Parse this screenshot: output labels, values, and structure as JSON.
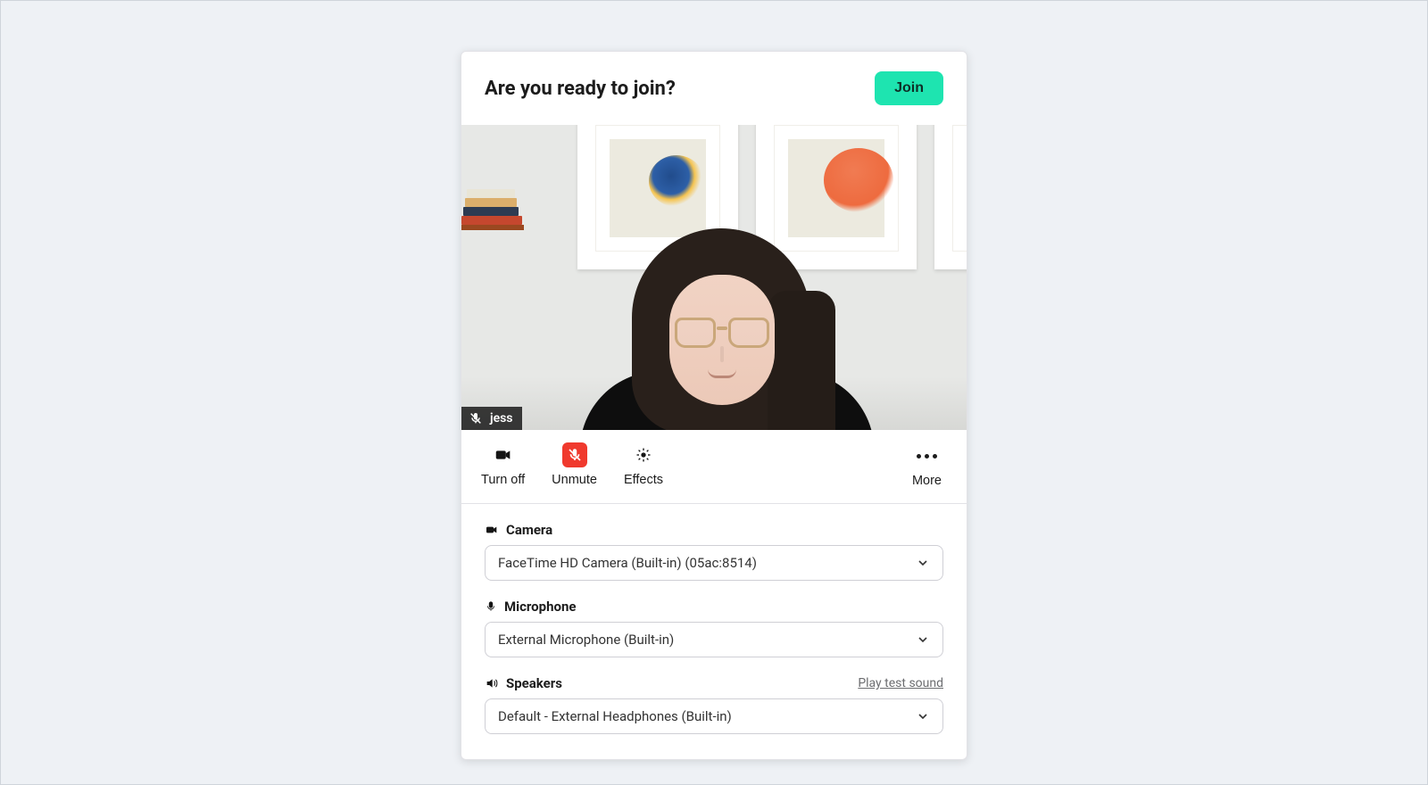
{
  "header": {
    "title": "Are you ready to join?",
    "join_label": "Join"
  },
  "preview": {
    "participant_name": "jess"
  },
  "actions": {
    "camera_label": "Turn off",
    "mic_label": "Unmute",
    "effects_label": "Effects",
    "more_label": "More"
  },
  "devices": {
    "camera": {
      "label": "Camera",
      "value": "FaceTime HD Camera (Built-in) (05ac:8514)"
    },
    "microphone": {
      "label": "Microphone",
      "value": "External Microphone (Built-in)"
    },
    "speakers": {
      "label": "Speakers",
      "value": "Default - External Headphones (Built-in)",
      "test_label": "Play test sound"
    }
  }
}
